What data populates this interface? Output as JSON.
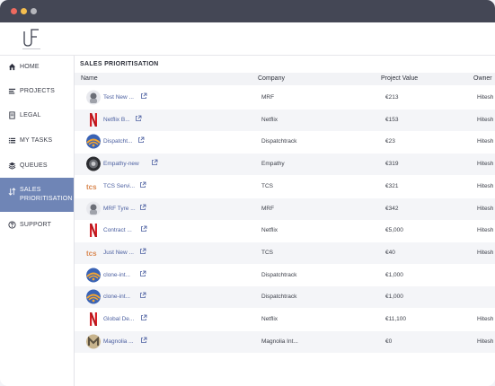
{
  "sidebar": {
    "items": [
      {
        "label": "HOME",
        "icon": "home-icon"
      },
      {
        "label": "PROJECTS",
        "icon": "list-icon"
      },
      {
        "label": "LEGAL",
        "icon": "document-icon"
      },
      {
        "label": "MY TASKS",
        "icon": "tasks-icon"
      },
      {
        "label": "QUEUES",
        "icon": "stack-icon"
      },
      {
        "label_line1": "SALES",
        "label_line2": "PRIORITISATION",
        "icon": "sort-icon"
      },
      {
        "label": "SUPPORT",
        "icon": "help-icon"
      }
    ]
  },
  "main": {
    "title": "SALES PRIORITISATION",
    "columns": [
      "Name",
      "Company",
      "Project Value",
      "Owner"
    ],
    "rows": [
      {
        "name": "Test New ...",
        "company": "MRF",
        "value": "€213",
        "owner": "Hitesh",
        "logo": "mrf"
      },
      {
        "name": "Netflix B...",
        "company": "Netflix",
        "value": "€153",
        "owner": "Hitesh",
        "logo": "netflix"
      },
      {
        "name": "Dispatcht...",
        "company": "Dispatchtrack",
        "value": "€23",
        "owner": "Hitesh",
        "logo": "dispatch"
      },
      {
        "name": "Empathy-new",
        "company": "Empathy",
        "value": "€319",
        "owner": "Hitesh",
        "logo": "empathy"
      },
      {
        "name": "TCS Servi...",
        "company": "TCS",
        "value": "€321",
        "owner": "Hitesh",
        "logo": "tcs"
      },
      {
        "name": "MRF Tyre ...",
        "company": "MRF",
        "value": "€342",
        "owner": "Hitesh",
        "logo": "mrf"
      },
      {
        "name": "Contract ...",
        "company": "Netflix",
        "value": "€5,000",
        "owner": "Hitesh",
        "logo": "netflix"
      },
      {
        "name": "Just New ...",
        "company": "TCS",
        "value": "€40",
        "owner": "Hitesh",
        "logo": "tcs"
      },
      {
        "name": "clone-int...",
        "company": "Dispatchtrack",
        "value": "€1,000",
        "owner": "",
        "logo": "dispatch"
      },
      {
        "name": "clone-int...",
        "company": "Dispatchtrack",
        "value": "€1,000",
        "owner": "",
        "logo": "dispatch"
      },
      {
        "name": "Global De...",
        "company": "Netflix",
        "value": "€11,100",
        "owner": "Hitesh",
        "logo": "netflix"
      },
      {
        "name": "Magnolia ...",
        "company": "Magnolia Int...",
        "value": "€0",
        "owner": "Hitesh",
        "logo": "magnolia"
      }
    ]
  },
  "colors": {
    "titlebar": "#444755",
    "accent": "#6f85b6",
    "link": "#4b5fa0",
    "netflix": "#d81f26",
    "tcs": "#d9864e"
  }
}
